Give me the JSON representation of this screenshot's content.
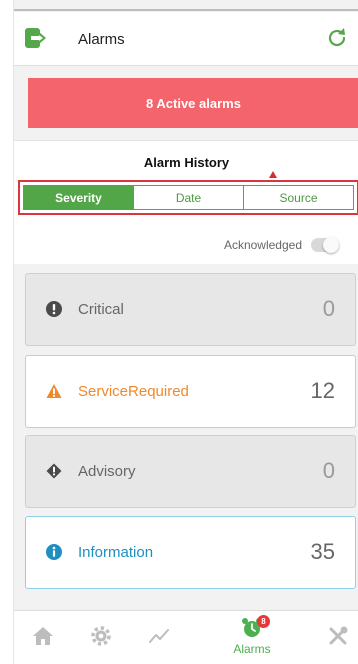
{
  "header": {
    "title": "Alarms"
  },
  "banner": {
    "text": "8 Active alarms"
  },
  "history": {
    "title": "Alarm History",
    "tabs": [
      {
        "label": "Severity",
        "active": true
      },
      {
        "label": "Date",
        "active": false
      },
      {
        "label": "Source",
        "active": false
      }
    ],
    "acknowledged_label": "Acknowledged",
    "acknowledged_on": false
  },
  "alarm_types": [
    {
      "label": "Critical",
      "count": "0",
      "icon": "exclamation-circle-icon"
    },
    {
      "label": "ServiceRequired",
      "count": "12",
      "icon": "warning-triangle-icon"
    },
    {
      "label": "Advisory",
      "count": "0",
      "icon": "exclamation-diamond-icon"
    },
    {
      "label": "Information",
      "count": "35",
      "icon": "info-circle-icon"
    }
  ],
  "nav": {
    "alarms_label": "Alarms",
    "alarms_badge": "8",
    "items": [
      "home-icon",
      "gear-icon",
      "trend-icon",
      "alarm-clock-icon",
      "tools-icon"
    ]
  },
  "colors": {
    "accent_green": "#52a647",
    "banner_red": "#f4646c",
    "outline_red": "#d9363e",
    "warning_orange": "#f0892b",
    "info_blue": "#1f8fc2"
  }
}
